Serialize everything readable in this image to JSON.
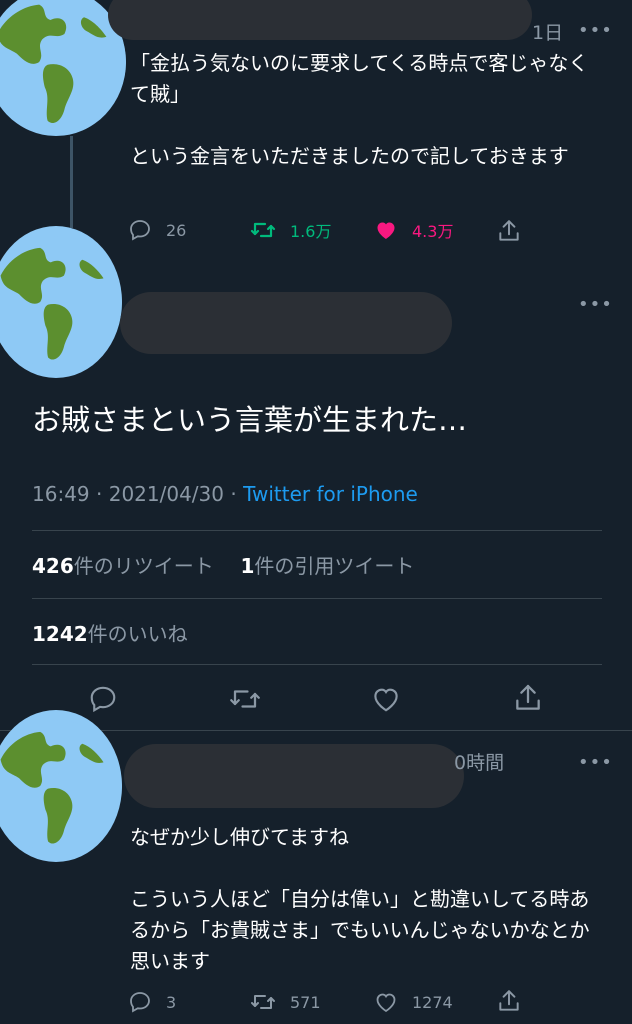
{
  "tweet1": {
    "time": "1日",
    "text": "「金払う気ないのに要求してくる時点で客じゃなくて賊」\n\nという金言をいただきましたので記しておきます",
    "replies": "26",
    "retweets": "1.6万",
    "likes": "4.3万"
  },
  "main_tweet": {
    "text": "お賊さまという言葉が生まれた…",
    "time": "16:49",
    "date": "2021/04/30",
    "source": "Twitter for iPhone",
    "retweet_count": "426",
    "retweet_label": "件のリツイート",
    "quote_count": "1",
    "quote_label": "件の引用ツイート",
    "like_count": "1242",
    "like_label": "件のいいね"
  },
  "reply": {
    "time_fragment": "0時間",
    "text": "なぜか少し伸びてますね\n\nこういう人ほど「自分は偉い」と勘違いしてる時あるから「お貴賊さま」でもいいんじゃないかなとか思います",
    "replies": "3",
    "retweets": "571",
    "likes": "1274"
  },
  "colors": {
    "background": "#15202b",
    "retweet_green": "#00ba7c",
    "like_pink": "#f91880",
    "link_blue": "#1d9bf0",
    "muted": "#8b98a5"
  },
  "icons": [
    "earth-icon",
    "reply-icon",
    "retweet-icon",
    "like-icon",
    "share-icon",
    "more-icon"
  ]
}
